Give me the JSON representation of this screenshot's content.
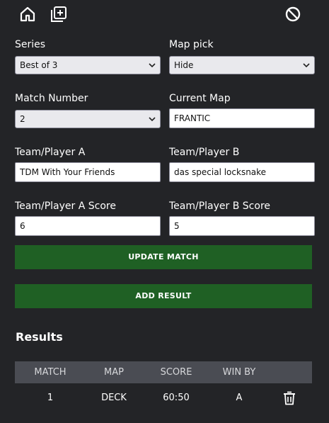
{
  "toolbar": {
    "home_icon": "home-icon",
    "add_icon": "add-square-icon",
    "clear_icon": "ban-icon"
  },
  "form": {
    "series": {
      "label": "Series",
      "value": "Best of 3"
    },
    "map_pick": {
      "label": "Map pick",
      "value": "Hide"
    },
    "match_number": {
      "label": "Match Number",
      "value": "2"
    },
    "current_map": {
      "label": "Current Map",
      "value": "FRANTIC"
    },
    "team_a": {
      "label": "Team/Player A",
      "value": "TDM With Your Friends"
    },
    "team_b": {
      "label": "Team/Player B",
      "value": "das special locksnake"
    },
    "team_a_score": {
      "label": "Team/Player A Score",
      "value": "6"
    },
    "team_b_score": {
      "label": "Team/Player B Score",
      "value": "5"
    }
  },
  "buttons": {
    "update": "UPDATE MATCH",
    "add_result": "ADD RESULT"
  },
  "results": {
    "title": "Results",
    "columns": [
      "MATCH",
      "MAP",
      "SCORE",
      "WIN BY"
    ],
    "rows": [
      {
        "match": "1",
        "map": "DECK",
        "score": "60:50",
        "win_by": "A"
      }
    ]
  },
  "colors": {
    "background": "#232427",
    "button": "#1f6024",
    "table_header": "#4a4c53"
  }
}
